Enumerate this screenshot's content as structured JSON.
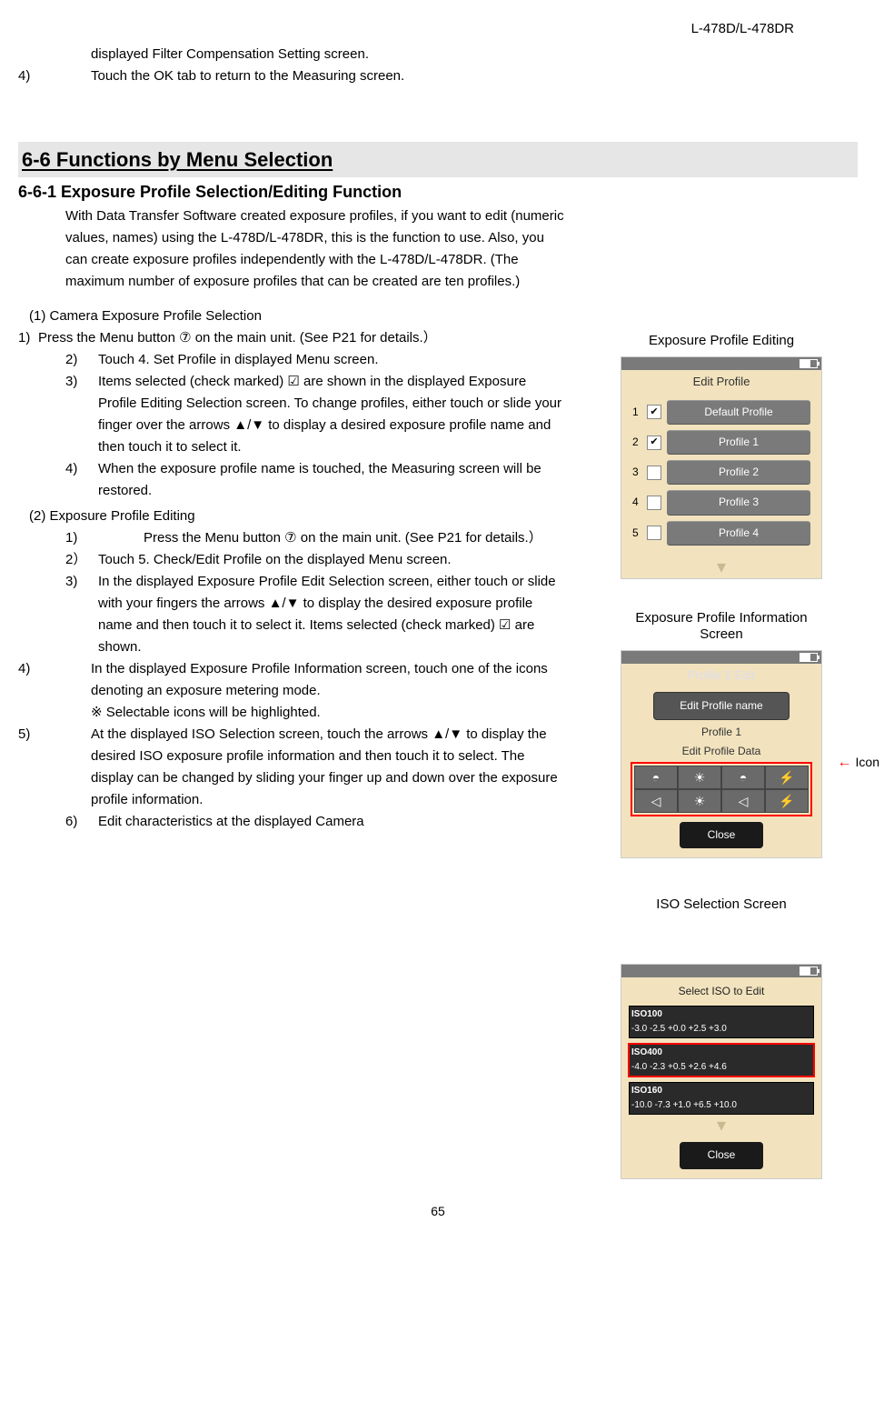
{
  "header_model": "L-478D/L-478DR",
  "intro_indent": "displayed Filter Compensation Setting screen.",
  "intro_step_n": "4)",
  "intro_step_txt": "Touch the OK tab to return to the Measuring screen.",
  "section_title": "6-6 Functions by Menu Selection",
  "sub_title": "6-6-1 Exposure Profile Selection/Editing Function",
  "intro_para": "With Data Transfer Software created exposure profiles, if you want to edit (numeric values, names) using the L-478D/L-478DR, this is the function to use. Also, you can create exposure profiles independently with the L-478D/L-478DR. (The maximum number of exposure profiles that can be created are ten profiles.)",
  "sub1_title": "(1) Camera Exposure Profile Selection",
  "sub1_step1": "Press the Menu button ⑦ on the main unit. (See P21 for details.）",
  "sub1_step1_n": "1)",
  "sub1_step2_n": "2)",
  "sub1_step2": "Touch 4. Set Profile in displayed Menu screen.",
  "sub1_step3_n": "3)",
  "sub1_step3": "Items selected (check marked) ☑ are shown in the displayed Exposure Profile Editing Selection screen. To change profiles, either touch or slide your finger over the arrows ▲/▼ to display a desired exposure profile name and then touch it to select it.",
  "sub1_step4_n": "4)",
  "sub1_step4": "When the exposure profile name is touched, the Measuring screen will be restored.",
  "sub2_title": "(2) Exposure Profile Editing",
  "sub2_step1_n": "1)",
  "sub2_step1": "Press the Menu button ⑦ on the main unit. (See P21 for details.）",
  "sub2_step2_n": "2）",
  "sub2_step2": "Touch 5. Check/Edit Profile on the displayed Menu screen.",
  "sub2_step3_n": "3)",
  "sub2_step3": "In the displayed Exposure Profile Edit Selection screen, either touch or slide with your fingers the arrows ▲/▼ to display the desired exposure profile name and then touch it to select it. Items selected (check marked) ☑ are shown.",
  "sub2_step4_n": "4)",
  "sub2_step4": "In the displayed Exposure Profile Information screen, touch one of the icons denoting an exposure metering mode.",
  "sub2_step4_note": "※ Selectable icons will be highlighted.",
  "sub2_step5_n": "5)",
  "sub2_step5": "At the displayed ISO Selection screen, touch the arrows ▲/▼ to display the desired ISO exposure profile information and then touch it to select. The display can be changed by sliding your finger up and down over the exposure profile information.",
  "sub2_step6_n": "6)",
  "sub2_step6": "Edit characteristics at the displayed Camera",
  "page_num": "65",
  "cap1": "Exposure Profile Editing",
  "cap2_l1": "Exposure Profile Information",
  "cap2_l2": "Screen",
  "cap3": "ISO Selection Screen",
  "icon_label": "Icon",
  "screen1": {
    "title": "Edit Profile",
    "rows": [
      {
        "n": "1",
        "checked": true,
        "label": "Default Profile"
      },
      {
        "n": "2",
        "checked": true,
        "label": "Profile 1"
      },
      {
        "n": "3",
        "checked": false,
        "label": "Profile 2"
      },
      {
        "n": "4",
        "checked": false,
        "label": "Profile 3"
      },
      {
        "n": "5",
        "checked": false,
        "label": "Profile 4"
      }
    ]
  },
  "screen2": {
    "title": "Profile 2 Edit",
    "btn1": "Edit Profile name",
    "lbl1": "Profile 1",
    "lbl2": "Edit Profile Data",
    "close": "Close"
  },
  "screen3": {
    "title": "Select ISO to Edit",
    "rows": [
      {
        "h": "ISO100",
        "v": "-3.0  -2.5  +0.0  +2.5  +3.0",
        "sel": false
      },
      {
        "h": "ISO400",
        "v": "-4.0  -2.3  +0.5  +2.6  +4.6",
        "sel": true
      },
      {
        "h": "ISO160",
        "v": "-10.0  -7.3  +1.0  +6.5  +10.0",
        "sel": false
      }
    ],
    "close": "Close"
  }
}
